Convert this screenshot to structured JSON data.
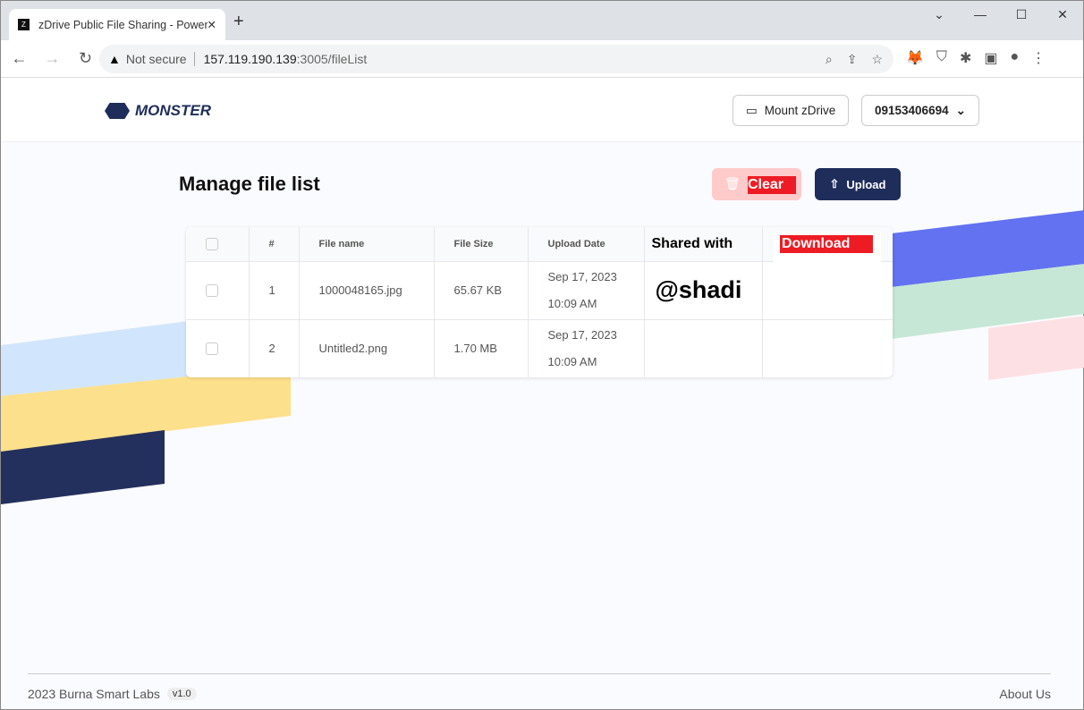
{
  "browser": {
    "tab_title": "zDrive Public File Sharing - Powered",
    "favicon": "Z",
    "url_host": "157.119.190.139",
    "url_rest": ":3005/fileList",
    "security": "Not secure"
  },
  "header": {
    "logo": "MONSTER",
    "mount": "Mount zDrive",
    "account": "09153406694"
  },
  "page": {
    "title": "Manage file list",
    "clear": "Clear",
    "upload": "Upload"
  },
  "table": {
    "headers": [
      "#",
      "File name",
      "File Size",
      "Upload Date",
      "Shared with",
      "Download"
    ],
    "rows": [
      {
        "num": "1",
        "name": "1000048165.jpg",
        "size": "65.67 KB",
        "date": "Sep 17, 2023",
        "time": "10:09 AM",
        "shared": "@shadi"
      },
      {
        "num": "2",
        "name": "Untitled2.png",
        "size": "1.70 MB",
        "date": "Sep 17, 2023",
        "time": "10:09 AM",
        "shared": ""
      }
    ]
  },
  "footer": {
    "copyright": "2023 Burna Smart Labs",
    "version": "v1.0",
    "about": "About Us"
  }
}
